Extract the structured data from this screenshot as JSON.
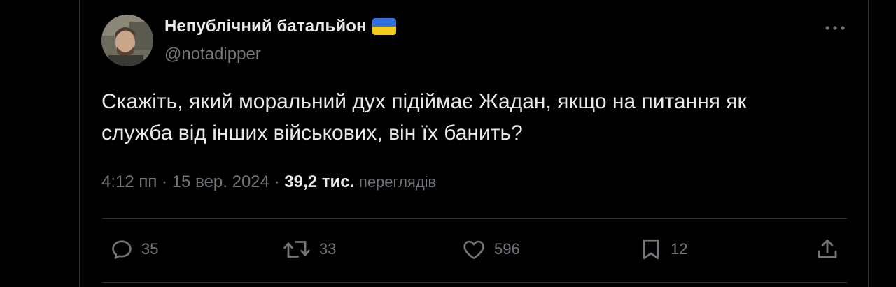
{
  "tweet": {
    "author": {
      "display_name": "Непублічний батальйон",
      "handle": "@notadipper",
      "flag_icon": "ukraine-flag-icon",
      "flag_colors": [
        "#2f6fe0",
        "#f5cc1a"
      ]
    },
    "text_line1": "Скажіть, який моральний дух підіймає Жадан, якщо на питання як",
    "text_line2": "служба від інших військових, він їх банить?",
    "time": "4:12 пп",
    "date": "15 вер. 2024",
    "views_count": "39,2 тис.",
    "views_label": "переглядів",
    "actions": {
      "replies": "35",
      "reposts": "33",
      "likes": "596",
      "bookmarks": "12"
    }
  },
  "colors": {
    "background": "#000000",
    "text_primary": "#e7e9ea",
    "text_secondary": "#71767b",
    "border": "#2f3336"
  }
}
